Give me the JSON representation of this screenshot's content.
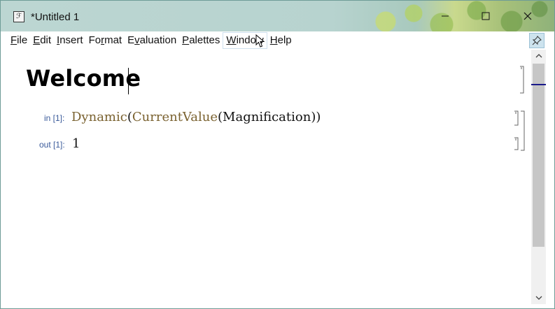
{
  "window": {
    "title": "*Untitled 1",
    "app_icon_glyph": "ℱ"
  },
  "controls": {
    "minimize_icon": "minimize-icon",
    "maximize_icon": "maximize-icon",
    "close_icon": "close-icon"
  },
  "menu": {
    "items": [
      {
        "pre": "",
        "ul": "F",
        "post": "ile"
      },
      {
        "pre": "",
        "ul": "E",
        "post": "dit"
      },
      {
        "pre": "",
        "ul": "I",
        "post": "nsert"
      },
      {
        "pre": "Fo",
        "ul": "r",
        "post": "mat"
      },
      {
        "pre": "E",
        "ul": "v",
        "post": "aluation"
      },
      {
        "pre": "",
        "ul": "P",
        "post": "alettes"
      },
      {
        "pre": "",
        "ul": "W",
        "post": "indow"
      },
      {
        "pre": "",
        "ul": "H",
        "post": "elp"
      }
    ]
  },
  "notebook": {
    "heading": "Welcome",
    "input_label": "in [1]:",
    "output_label": "out [1]:",
    "input": {
      "fn1": "Dynamic",
      "open1": "(",
      "fn2": "CurrentValue",
      "open2": "(",
      "arg": "Magnification",
      "close": "))"
    },
    "output_value": "1"
  },
  "colors": {
    "label": "#3a5a9a",
    "function": "#7a6230",
    "scroll_marker": "#1a1a8a"
  }
}
